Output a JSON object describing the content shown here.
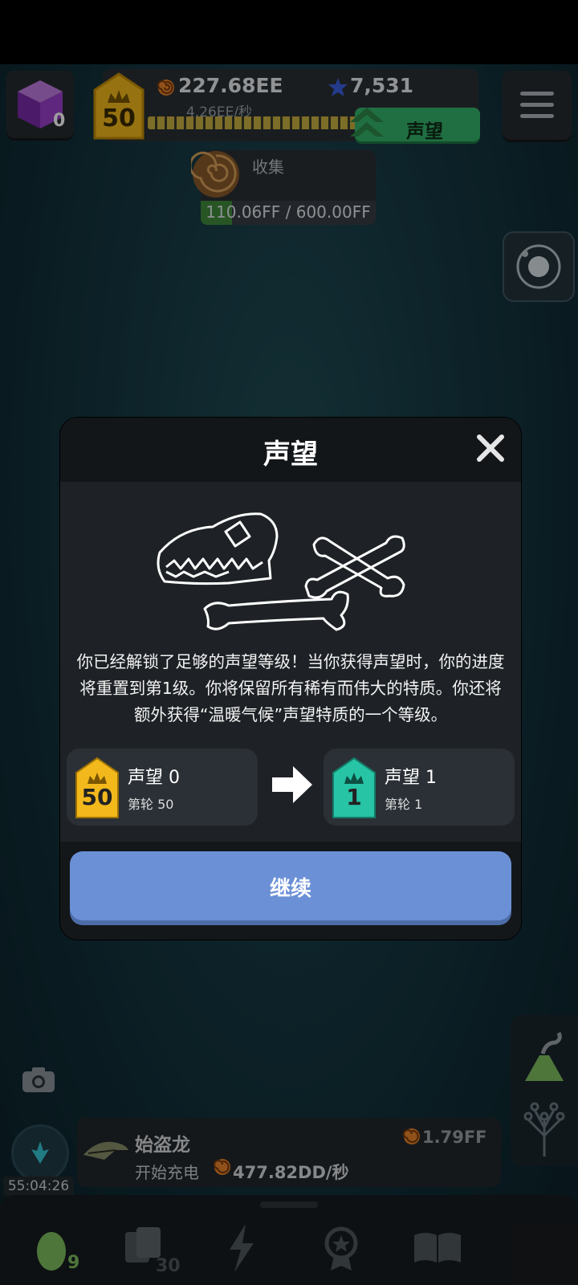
{
  "status_bar": {},
  "hud": {
    "cube_count": "0",
    "level": "50",
    "currency_amount": "227.68EE",
    "currency_rate": "4.26EE/秒",
    "gem_amount": "7,531",
    "prestige_button": "声望",
    "collect_label": "收集",
    "collect_value": "110.06FF / 600.00FF",
    "collect_progress": 0.18
  },
  "modal": {
    "title": "声望",
    "description": "你已经解锁了足够的声望等级！当你获得声望时，你的进度将重置到第1级。你将保留所有稀有而伟大的特质。你还将额外获得“温暖气候”声望特质的一个等级。",
    "from": {
      "badge": "50",
      "title": "声望 0",
      "sub": "第轮 50"
    },
    "to": {
      "badge": "1",
      "title": "声望 1",
      "sub": "第轮 1"
    },
    "continue_button": "继续",
    "colors": {
      "gold": "#f2b81c",
      "teal": "#27c4a6",
      "button": "#6b90d6"
    }
  },
  "bottom": {
    "timer": "55:04:26",
    "dino": {
      "name": "始盗龙",
      "cost": "1.79FF",
      "action": "开始充电",
      "rate": "477.82DD/秒"
    },
    "nav": {
      "eggs_count": "9",
      "cards_count": "30"
    }
  }
}
